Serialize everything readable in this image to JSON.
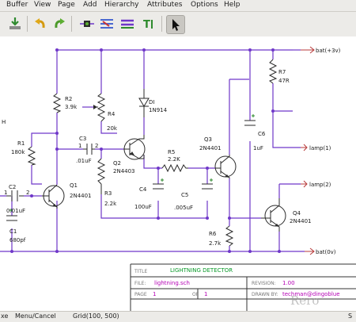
{
  "menu": {
    "items": [
      "Buffer",
      "View",
      "Page",
      "Add",
      "Hierarchy",
      "Attributes",
      "Options",
      "Help"
    ]
  },
  "toolbar": {
    "buttons": [
      "save-icon",
      "undo-icon",
      "redo-icon",
      "add-component-icon",
      "add-net-icon",
      "add-bus-icon",
      "add-text-icon",
      "select-pointer-icon"
    ]
  },
  "schematic": {
    "ports": {
      "bat_pos": "bat(+3v)",
      "bat_neg": "bat(0v)",
      "lamp1": "lamp(1)",
      "lamp2": "lamp(2)"
    },
    "components": {
      "r1": {
        "ref": "R1",
        "value": "180k"
      },
      "r2": {
        "ref": "R2",
        "value": "3.9k"
      },
      "r3": {
        "ref": "R3",
        "value": "2.2k"
      },
      "r4": {
        "ref": "R4",
        "value": "20k"
      },
      "r5": {
        "ref": "R5",
        "value": "2.2K"
      },
      "r6": {
        "ref": "R6",
        "value": "2.7k"
      },
      "r7": {
        "ref": "R7",
        "value": "47R"
      },
      "c1": {
        "ref": "C1",
        "value": "680pf"
      },
      "c2": {
        "ref": "C2",
        "value": "0.01uF"
      },
      "c3": {
        "ref": "C3",
        "value": ".01uF"
      },
      "c4": {
        "ref": "C4",
        "value": "100uF"
      },
      "c5": {
        "ref": "C5",
        "value": ".005uF"
      },
      "c6": {
        "ref": "C6",
        "value": "1uF"
      },
      "d1": {
        "ref": "DI",
        "value": "1N914"
      },
      "q1": {
        "ref": "Q1",
        "value": "2N4401"
      },
      "q2": {
        "ref": "Q2",
        "value": "2N4403"
      },
      "q3": {
        "ref": "Q3",
        "value": "2N4401"
      },
      "q4": {
        "ref": "Q4",
        "value": "2N4401"
      }
    },
    "pin_numbers": {
      "c2_left": "1",
      "c2_right": "2",
      "c3_left": "1",
      "c3_right": "2"
    },
    "left_edge_label": "H"
  },
  "title_block": {
    "title_label": "TITLE",
    "title": "LIGHTNING DETECTOR",
    "file_label": "FILE:",
    "file": "lightning.sch",
    "revision_label": "REVISION:",
    "revision": "1.00",
    "page_label": "PAGE",
    "page": "1",
    "of_label": "OF",
    "of": "1",
    "drawn_label": "DRAWN BY:",
    "drawn_by": "techman@dingoblue"
  },
  "watermark": "Rero",
  "status": {
    "left_fragment": "xe",
    "hint": "Menu/Cancel",
    "grid": "Grid(100, 500)",
    "right_fragment": "S"
  },
  "colors": {
    "wire": "#6f37c9",
    "component": "#2a2a2a",
    "green": "#2d8a2d",
    "pin": "#b73a3a",
    "title_text": "#0a9a2a",
    "attribute_text": "#b500b5"
  }
}
